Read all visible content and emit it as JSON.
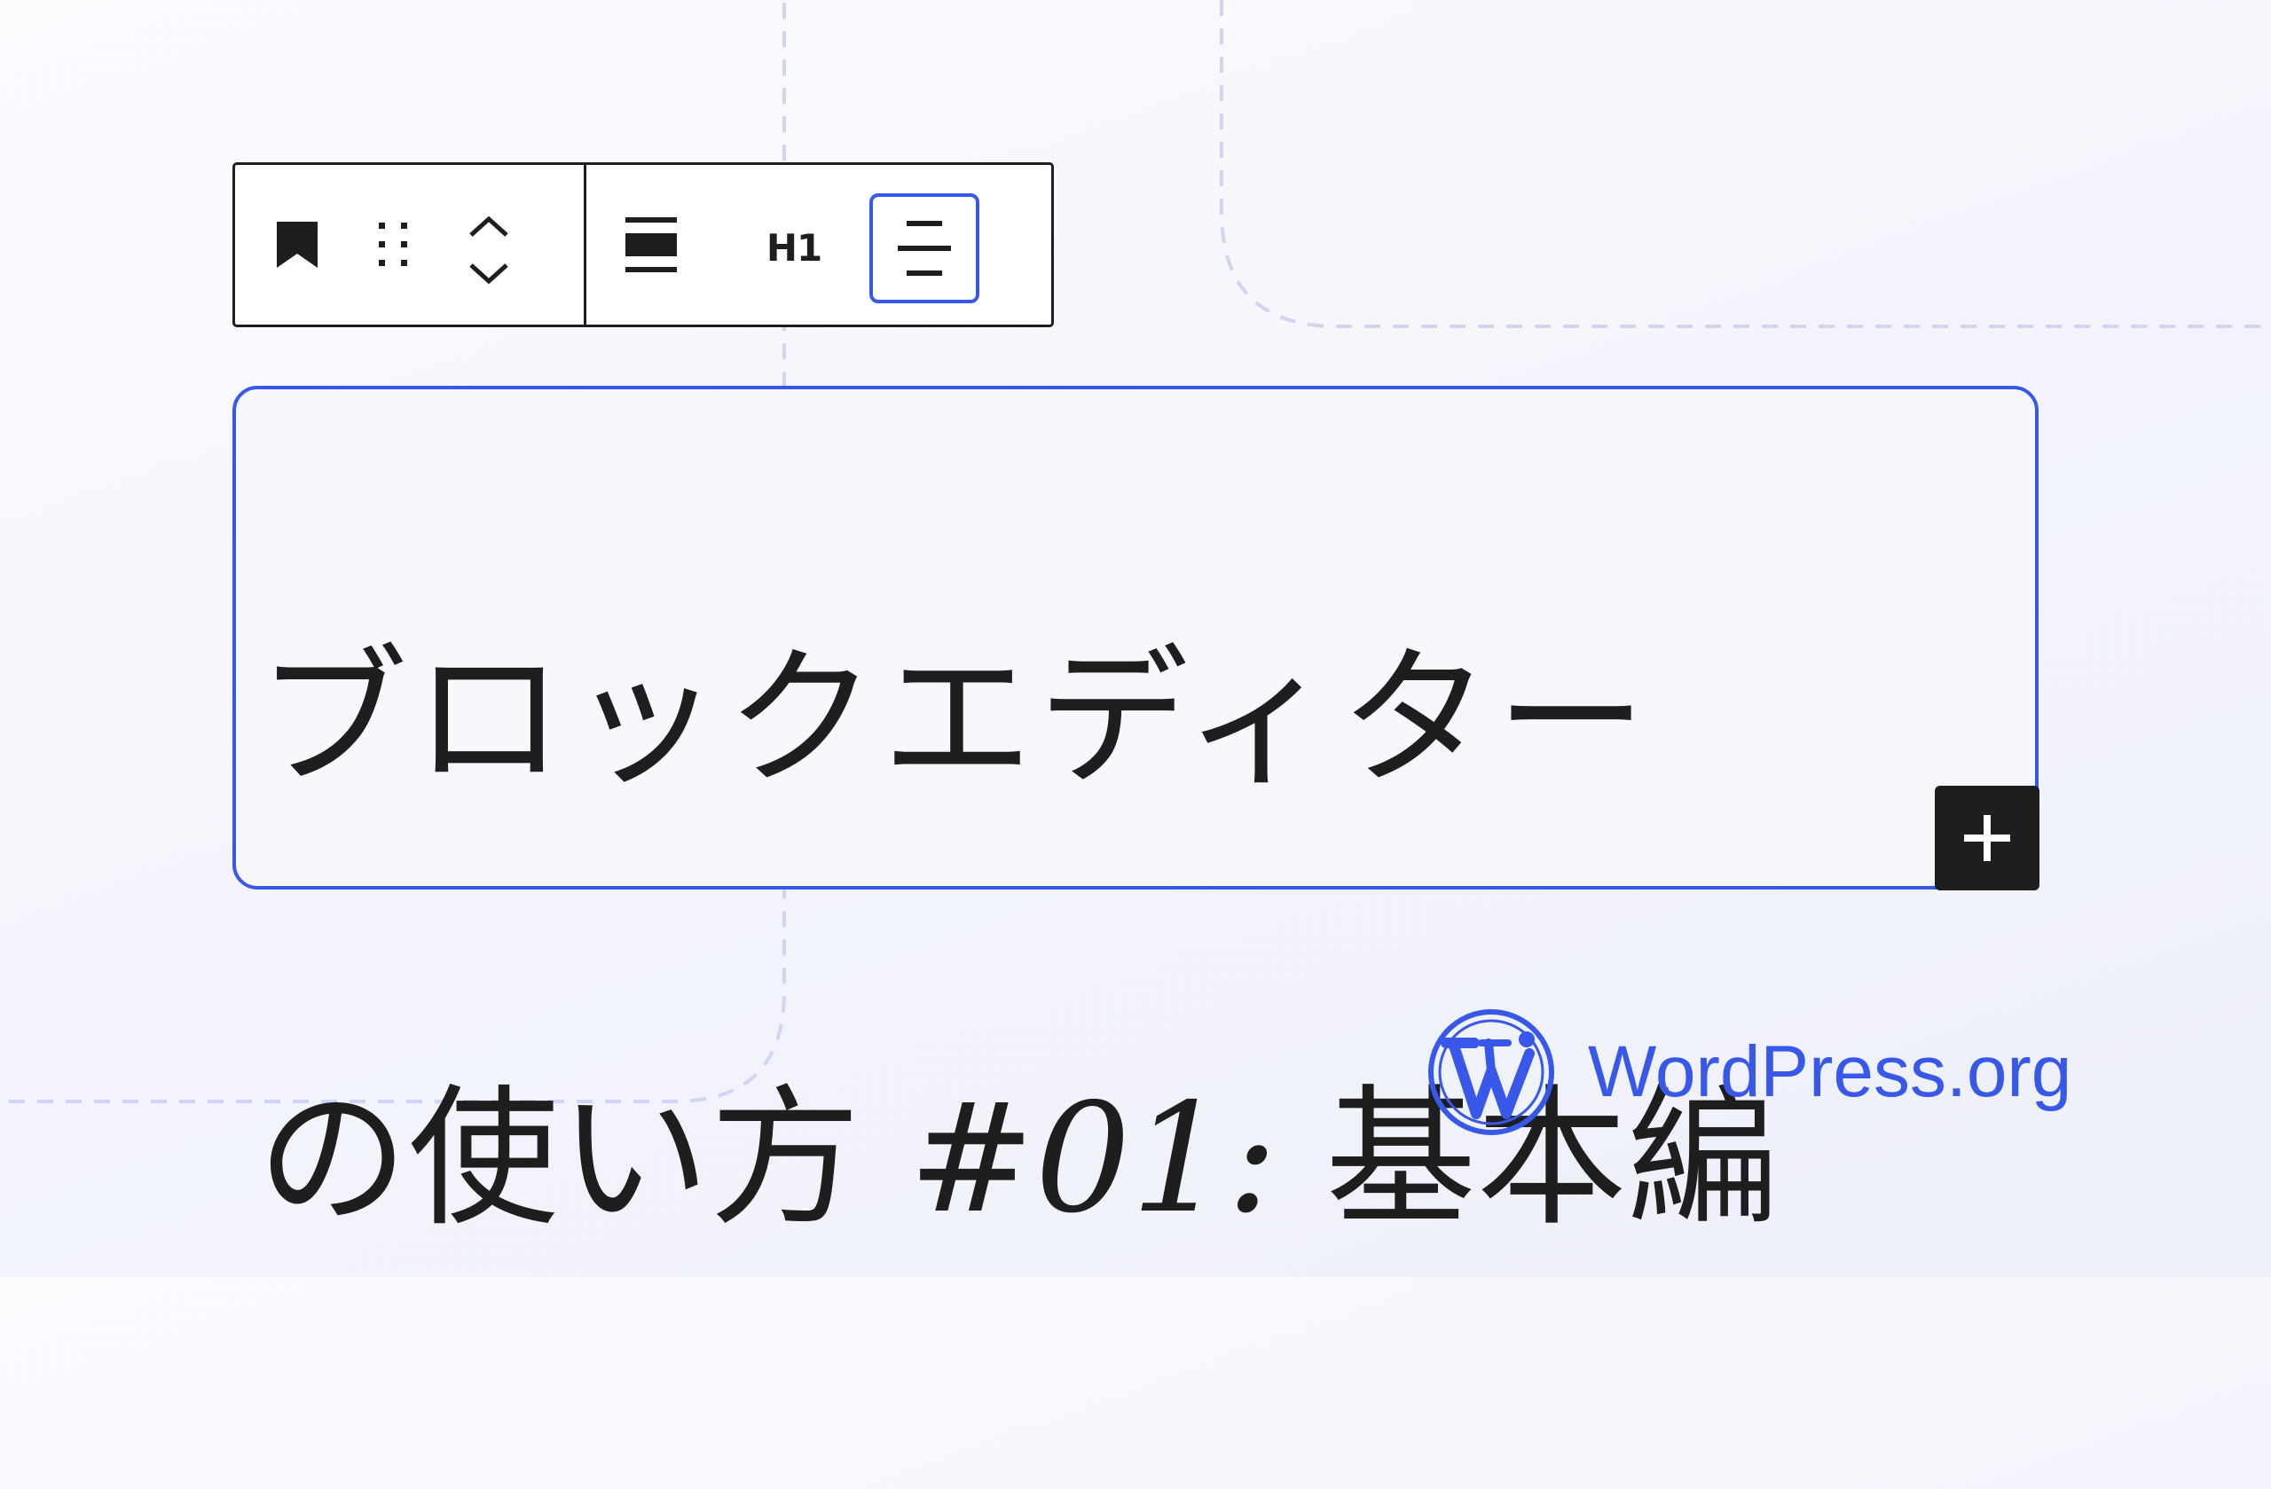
{
  "toolbar": {
    "block_icon": "bookmark-icon",
    "drag_icon": "drag-handle-icon",
    "move_icon": "chevron-up-down-icon",
    "transform_icon": "heading-block-icon",
    "heading_level": "H1",
    "align_icon": "align-center-icon"
  },
  "heading": {
    "line1": "ブロックエディター",
    "line2_prefix": "の使い方 ",
    "line2_number": "#01:",
    "line2_suffix": " 基本編"
  },
  "inserter": {
    "icon": "plus-icon"
  },
  "brand": {
    "wordmark": "WordPress.org",
    "logo_icon": "wordpress-logo-icon"
  },
  "colors": {
    "accent": "#3858e9",
    "text": "#1e1e1e",
    "guides": "#cfd5f3",
    "background": "#f3f4fb"
  }
}
